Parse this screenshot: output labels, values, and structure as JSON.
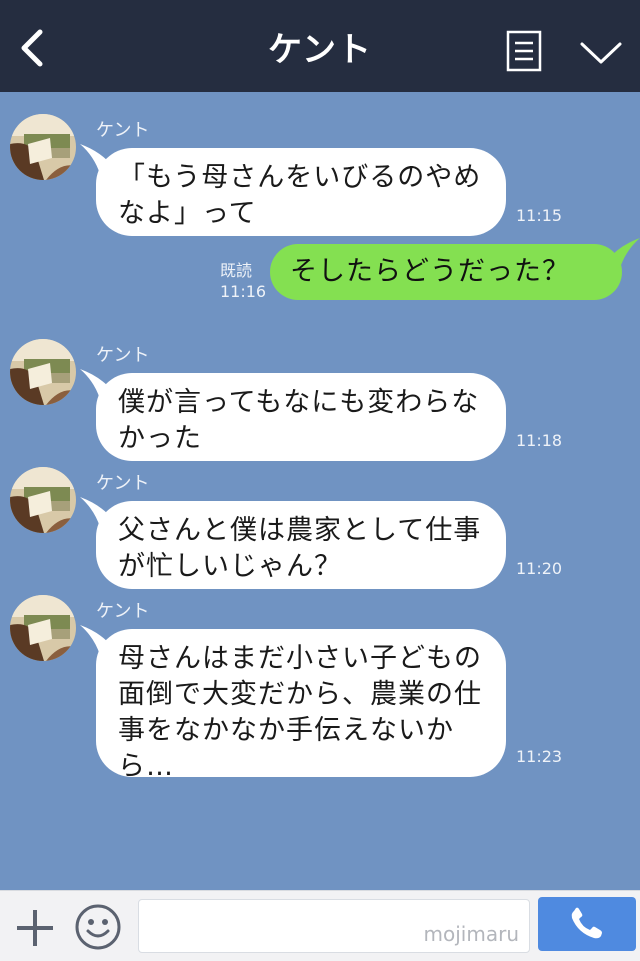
{
  "header": {
    "title": "ケント",
    "back_icon": "chevron-left-icon",
    "menu_icon": "document-list-icon",
    "more_icon": "chevron-down-icon"
  },
  "messages": [
    {
      "sender": "ケント",
      "text": "「もう母さんをいびるのやめなよ」って",
      "time": "11:15"
    },
    {
      "sender": "me",
      "text": "そしたらどうだった？",
      "read": "既読",
      "time": "11:16"
    },
    {
      "sender": "ケント",
      "text": "僕が言ってもなにも変わらなかった",
      "time": "11:18"
    },
    {
      "sender": "ケント",
      "text": "父さんと僕は農家として仕事が忙しいじゃん？",
      "time": "11:20"
    },
    {
      "sender": "ケント",
      "text": "母さんはまだ小さい子どもの面倒で大変だから、農業の仕事をなかなか手伝えないから…",
      "time": "11:23"
    }
  ],
  "footer": {
    "watermark": "mojimaru",
    "plus_icon": "plus-icon",
    "emoji_icon": "smile-icon",
    "call_icon": "phone-icon"
  },
  "colors": {
    "header_bg": "#252d40",
    "chat_bg": "#7093c2",
    "outgoing_bubble": "#84e051",
    "call_button": "#4f8ae0"
  }
}
